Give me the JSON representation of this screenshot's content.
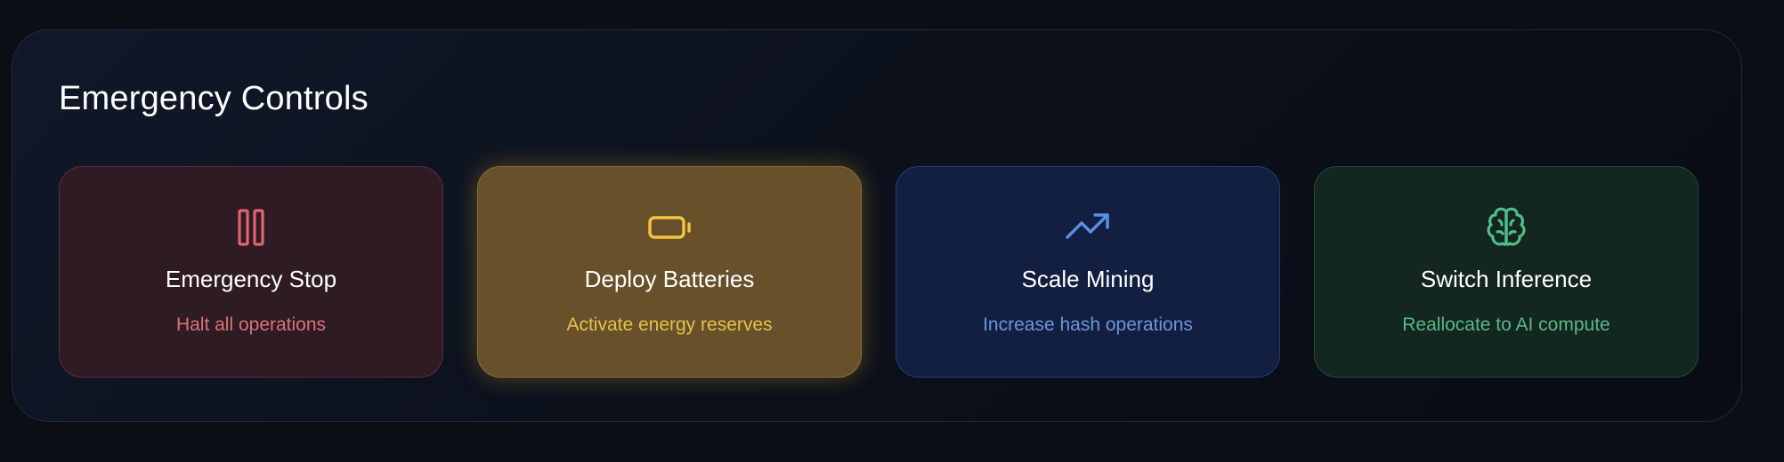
{
  "panel": {
    "title": "Emergency Controls"
  },
  "controls": [
    {
      "label": "Emergency Stop",
      "description": "Halt all operations",
      "icon": "pause-icon",
      "color": "#e0656f"
    },
    {
      "label": "Deploy Batteries",
      "description": "Activate energy reserves",
      "icon": "battery-icon",
      "color": "#f2c53d"
    },
    {
      "label": "Scale Mining",
      "description": "Increase hash operations",
      "icon": "trending-up-icon",
      "color": "#5b8fe6"
    },
    {
      "label": "Switch Inference",
      "description": "Reallocate to AI compute",
      "icon": "brain-icon",
      "color": "#4fc089"
    }
  ]
}
